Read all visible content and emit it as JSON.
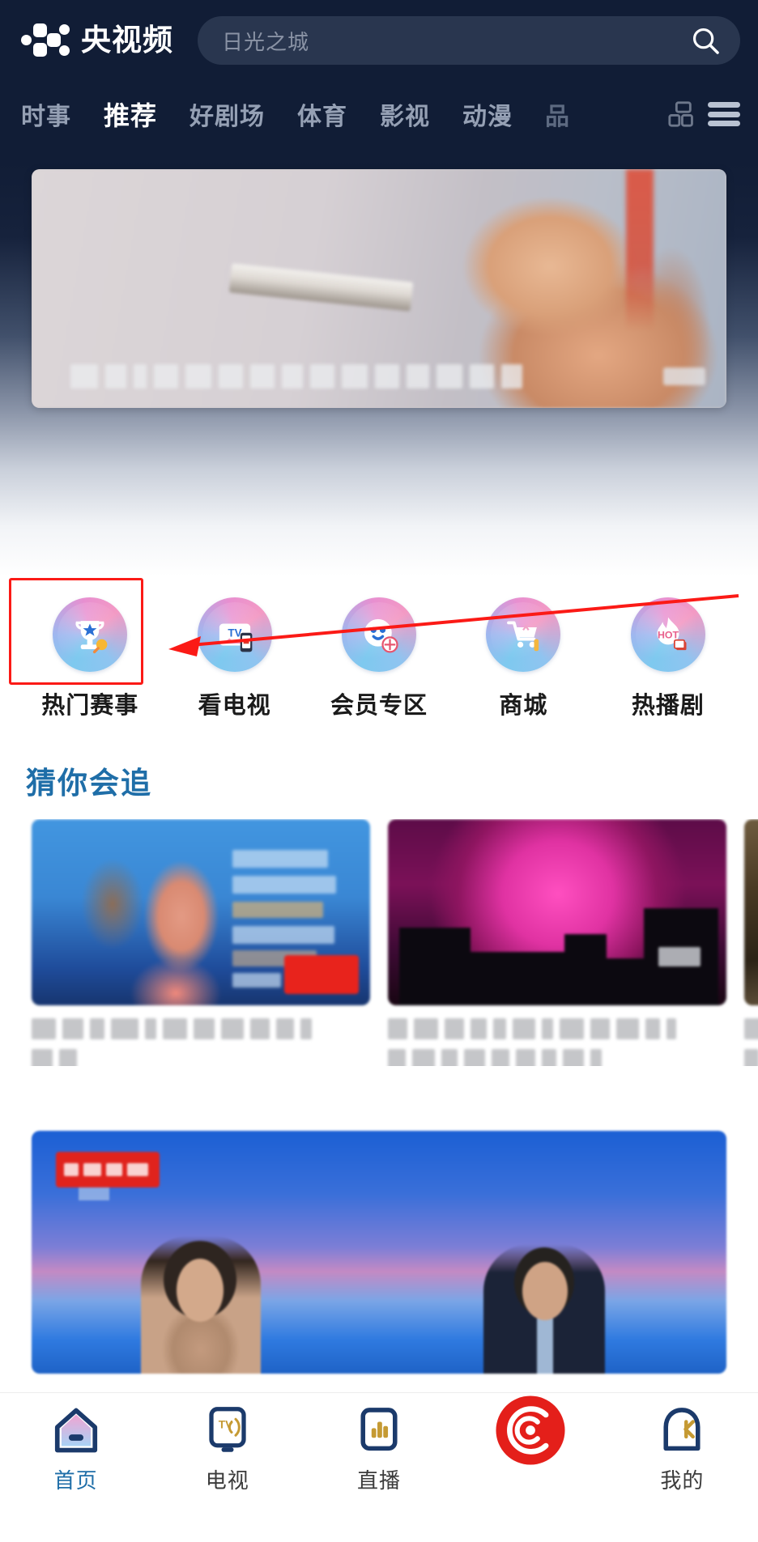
{
  "app": {
    "name": "央视频",
    "brand_color": "#111d36",
    "accent_color": "#1f6ea8",
    "record_button_color": "#e41f1a"
  },
  "search": {
    "placeholder": "日光之城",
    "icon": "search-icon"
  },
  "nav_tabs": [
    {
      "label": "时事",
      "active": false
    },
    {
      "label": "推荐",
      "active": true
    },
    {
      "label": "好剧场",
      "active": false
    },
    {
      "label": "体育",
      "active": false
    },
    {
      "label": "影视",
      "active": false
    },
    {
      "label": "动漫",
      "active": false
    },
    {
      "label": "品",
      "active": false
    }
  ],
  "nav_right": {
    "grid_icon": "grid-icon",
    "menu_icon": "hamburger-menu-icon"
  },
  "hero": {
    "caption": "",
    "badge": ""
  },
  "quick_access": [
    {
      "label": "热门赛事",
      "icon": "trophy-icon",
      "highlighted": true
    },
    {
      "label": "看电视",
      "icon": "tv-icon",
      "highlighted": false
    },
    {
      "label": "会员专区",
      "icon": "vip-member-icon",
      "highlighted": false
    },
    {
      "label": "商城",
      "icon": "shopping-cart-icon",
      "highlighted": false
    },
    {
      "label": "热播剧",
      "icon": "hot-flame-icon",
      "highlighted": false
    }
  ],
  "annotation": {
    "box_color": "#fb1a16",
    "arrow_color": "#fb1a16",
    "target": "热门赛事"
  },
  "section": {
    "title": "猜你会追"
  },
  "cards": [
    {
      "title": "",
      "thumb": "sports-athlete-thumb"
    },
    {
      "title": "",
      "thumb": "aurora-skyline-thumb"
    },
    {
      "title": "",
      "thumb": "partial-thumb"
    }
  ],
  "feature_card": {
    "badge": "",
    "thumb": "news-studio-anchors"
  },
  "bottom_nav": [
    {
      "label": "首页",
      "icon": "home-icon",
      "active": true
    },
    {
      "label": "电视",
      "icon": "tv-device-icon",
      "active": false
    },
    {
      "label": "直播",
      "icon": "live-bars-icon",
      "active": false
    },
    {
      "label": "",
      "icon": "record-cctv-icon",
      "active": false
    },
    {
      "label": "我的",
      "icon": "profile-icon",
      "active": false
    }
  ]
}
